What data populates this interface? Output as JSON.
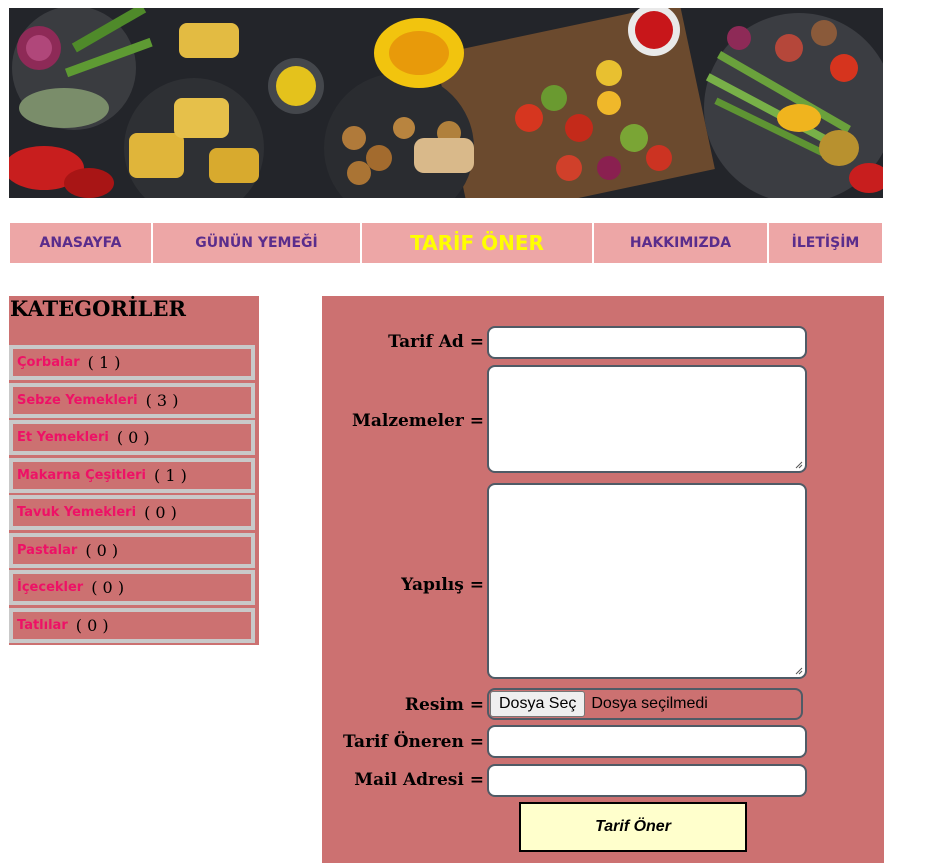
{
  "banner": {
    "image_name": "grilled-vegetables-banner"
  },
  "nav": {
    "items": [
      {
        "label": "ANASAYFA"
      },
      {
        "label": "GÜNÜN YEMEĞİ"
      },
      {
        "label": "TARİF ÖNER"
      },
      {
        "label": "HAKKIMIZDA"
      },
      {
        "label": "İLETİŞİM"
      }
    ],
    "active_index": 2
  },
  "sidebar": {
    "title": "KATEGORİLER",
    "categories": [
      {
        "name": "Çorbalar",
        "count": "( 1 )"
      },
      {
        "name": "Sebze Yemekleri",
        "count": "( 3 )"
      },
      {
        "name": "Et Yemekleri",
        "count": "( 0 )"
      },
      {
        "name": "Makarna Çeşitleri",
        "count": "( 1 )"
      },
      {
        "name": "Tavuk Yemekleri",
        "count": "( 0 )"
      },
      {
        "name": "Pastalar",
        "count": "( 0 )"
      },
      {
        "name": "İçecekler",
        "count": "( 0 )"
      },
      {
        "name": "Tatlılar",
        "count": "( 0 )"
      }
    ]
  },
  "form": {
    "labels": {
      "recipe_name": "Tarif Ad =",
      "ingredients": "Malzemeler =",
      "preparation": "Yapılış =",
      "image": "Resim =",
      "suggester": "Tarif Öneren =",
      "email": "Mail Adresi ="
    },
    "values": {
      "recipe_name": "",
      "ingredients": "",
      "preparation": "",
      "suggester": "",
      "email": ""
    },
    "file": {
      "button": "Dosya Seç",
      "status": "Dosya seçilmedi"
    },
    "submit": "Tarif Öner"
  },
  "colors": {
    "nav_bg": "#eda6a6",
    "nav_text": "#5a2d8c",
    "nav_active_text": "#ffff00",
    "panel_bg": "#cc7171",
    "category_link": "#ee1166",
    "category_border": "#c9c9c9",
    "submit_bg": "#ffffcc"
  }
}
